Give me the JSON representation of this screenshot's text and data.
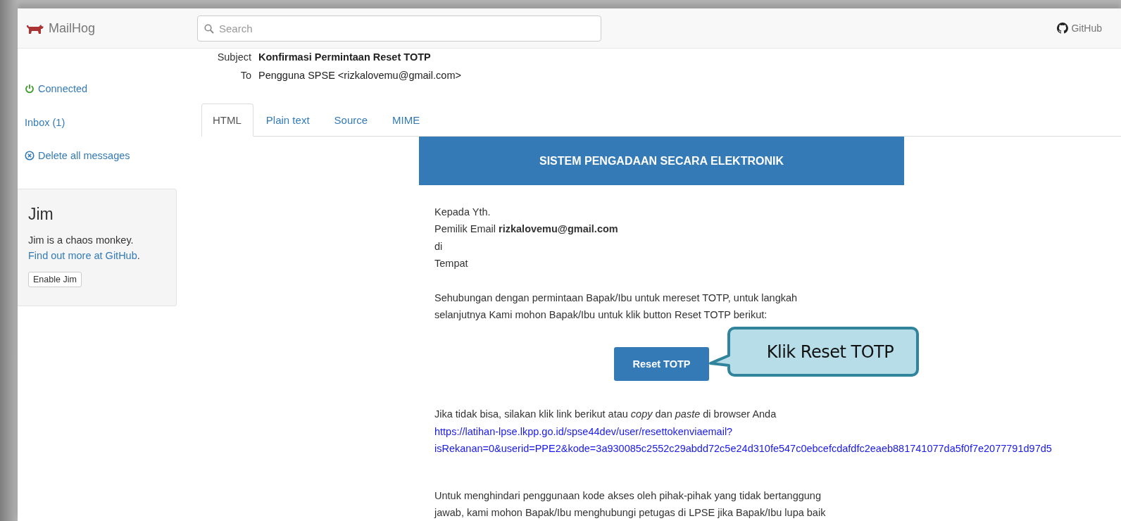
{
  "navbar": {
    "brand": "MailHog",
    "search": {
      "placeholder": "Search"
    },
    "github": "GitHub"
  },
  "sidebar": {
    "status": {
      "label": "Connected",
      "connected": true
    },
    "items": [
      {
        "label": "Inbox (1)",
        "kind": "link"
      },
      {
        "label": "Delete all messages",
        "kind": "delete"
      }
    ]
  },
  "jim": {
    "title": "Jim",
    "description": "Jim is a chaos monkey.",
    "link": "Find out more at GitHub",
    "link_suffix": ".",
    "button": "Enable Jim"
  },
  "headers": [
    {
      "label": "Subject",
      "value": "Konfirmasi Permintaan Reset TOTP",
      "bold": true
    },
    {
      "label": "To",
      "value": "Pengguna SPSE <rizkalovemu@gmail.com>",
      "bold": false
    }
  ],
  "tabs": [
    {
      "label": "HTML",
      "selected": true
    },
    {
      "label": "Plain text",
      "selected": false
    },
    {
      "label": "Source",
      "selected": false
    },
    {
      "label": "MIME",
      "selected": false
    }
  ],
  "email": {
    "banner": "SISTEM PENGADAAN SECARA ELEKTRONIK",
    "greeting": [
      "Kepada Yth.",
      "Pemilik Email **rizkalovemu@gmail.com**",
      "di",
      "Tempat"
    ],
    "intro": [
      "Sehubungan dengan permintaan Bapak/Ibu untuk mereset TOTP, untuk langkah",
      "selanjutnya Kami mohon Bapak/Ibu untuk klik button Reset TOTP berikut:"
    ],
    "button": "Reset TOTP",
    "fallback": "Jika tidak bisa, silakan klik link berikut atau *copy* dan *paste* di browser Anda",
    "link_lines": [
      "https://latihan-lpse.lkpp.go.id/spse44dev/user/resettokenviaemail?",
      "isRekanan=0&userid=PPE2&kode=3a930085c2552c29abdd72c5e24d310fe547c0ebcefcdafdfc2eaeb881741077da5f0f7e2077791d97d5"
    ],
    "warning": [
      "Untuk menghindari penggunaan kode akses oleh pihak-pihak yang tidak bertanggung",
      "jawab, kami mohon Bapak/Ibu menghubungi petugas di LPSE jika Bapak/Ibu lupa baik"
    ]
  },
  "callout": {
    "text": "Klik Reset TOTP"
  }
}
